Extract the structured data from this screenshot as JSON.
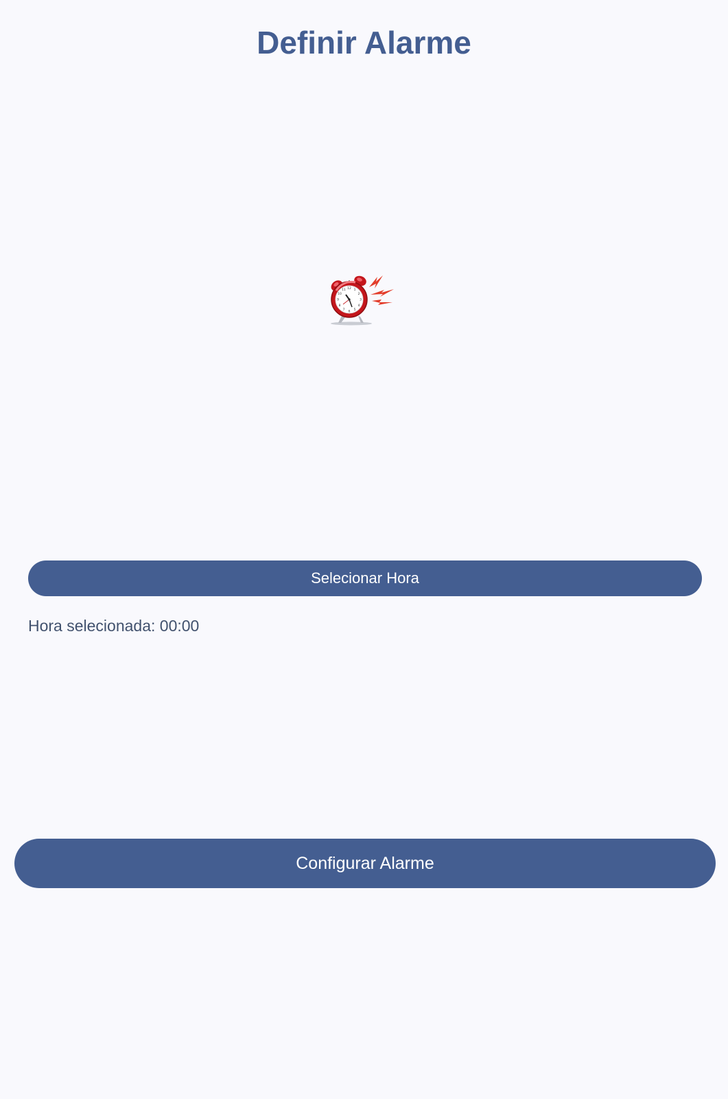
{
  "page": {
    "title": "Definir Alarme",
    "background": "#f9f9fd",
    "accent": "#445e91"
  },
  "illustration": {
    "icon": "alarm-clock-ringing-icon"
  },
  "time_picker": {
    "button_label": "Selecionar Hora",
    "selected_label": "Hora selecionada: 00:00"
  },
  "actions": {
    "configure_label": "Configurar Alarme"
  }
}
